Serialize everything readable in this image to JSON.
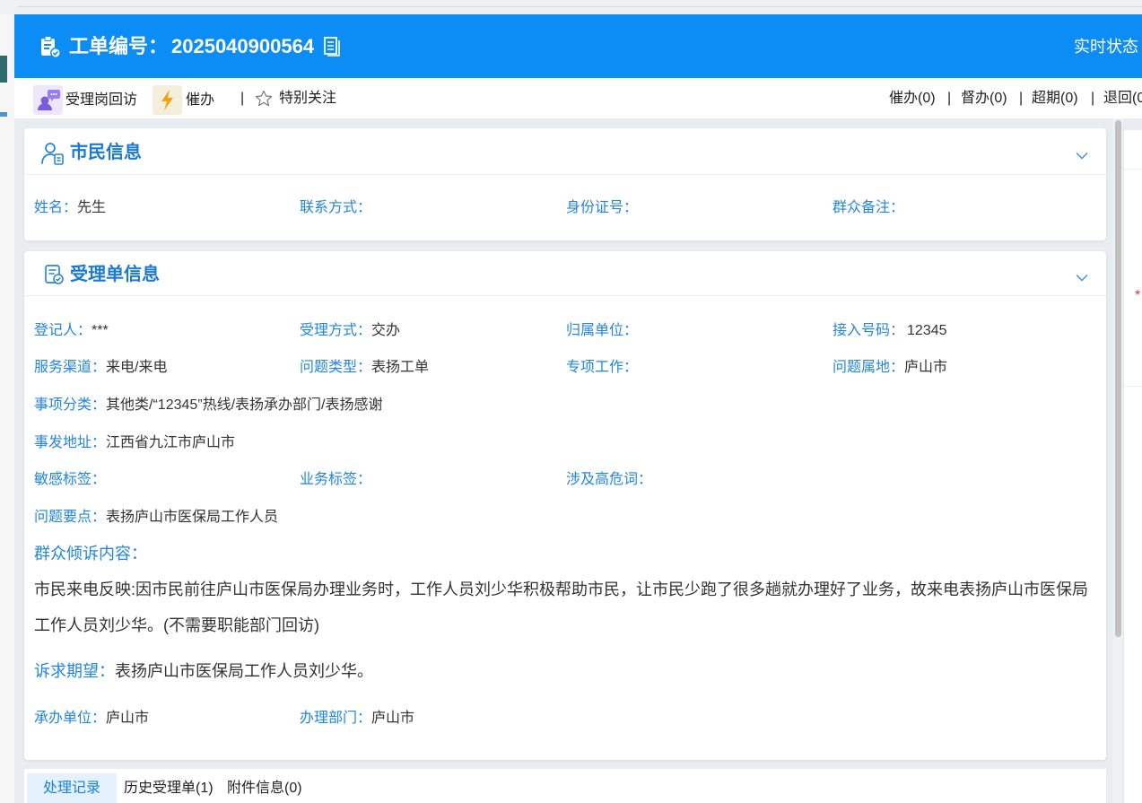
{
  "header": {
    "title_label": "工单编号：",
    "order_number": "2025040900564",
    "status_link": "实时状态"
  },
  "toolbar": {
    "separator": "|",
    "actions": [
      {
        "label": "受理岗回访",
        "icon": "user-chat-icon"
      },
      {
        "label": "催办",
        "icon": "lightning-icon"
      },
      {
        "label": "特别关注",
        "icon": "star-icon"
      }
    ],
    "counters": [
      "催办(0)",
      "督办(0)",
      "超期(0)",
      "退回(0"
    ]
  },
  "citizen": {
    "title": "市民信息",
    "name": {
      "label": "姓名：",
      "value": "先生"
    },
    "contact": {
      "label": "联系方式："
    },
    "id_number": {
      "label": "身份证号："
    },
    "remark": {
      "label": "群众备注："
    }
  },
  "acceptance": {
    "title": "受理单信息",
    "registrar": {
      "label": "登记人：",
      "value": "***"
    },
    "method": {
      "label": "受理方式：",
      "value": "交办"
    },
    "owner_unit": {
      "label": "归属单位："
    },
    "access_number": {
      "label": "接入号码：",
      "value": "12345"
    },
    "channel": {
      "label": "服务渠道：",
      "value": "来电/来电"
    },
    "issue_type": {
      "label": "问题类型：",
      "value": "表扬工单"
    },
    "special_work": {
      "label": "专项工作："
    },
    "issue_locale": {
      "label": "问题属地：",
      "value": "庐山市"
    },
    "category": {
      "label": "事项分类：",
      "value": "其他类/“12345”热线/表扬承办部门/表扬感谢"
    },
    "address": {
      "label": "事发地址：",
      "value": "江西省九江市庐山市"
    },
    "sensitive_tags": {
      "label": "敏感标签："
    },
    "business_tags": {
      "label": "业务标签："
    },
    "high_risk_words": {
      "label": "涉及高危词："
    },
    "key_points": {
      "label": "问题要点：",
      "value": "表扬庐山市医保局工作人员"
    },
    "complaint": {
      "label": "群众倾诉内容：",
      "content": "市民来电反映:因市民前往庐山市医保局办理业务时，工作人员刘少华积极帮助市民，让市民少跑了很多趟就办理好了业务，故来电表扬庐山市医保局工作人员刘少华。(不需要职能部门回访)"
    },
    "expectation": {
      "label": "诉求期望：",
      "value": "表扬庐山市医保局工作人员刘少华。"
    },
    "handling_unit": {
      "label": "承办单位：",
      "value": "庐山市"
    },
    "handling_dept": {
      "label": "办理部门：",
      "value": "庐山市"
    }
  },
  "tabs": [
    {
      "label": "处理记录",
      "active": true
    },
    {
      "label": "历史受理单(1)",
      "active": false
    },
    {
      "label": "附件信息(0)",
      "active": false
    }
  ],
  "side_panel": {
    "required_mark": "*"
  },
  "icons": {
    "header_title": "clipboard-check-icon",
    "header_copy": "document-icon",
    "citizen_section": "user-card-icon",
    "acceptance_section": "document-check-icon",
    "collapse": "chevron-down-icon"
  },
  "colors": {
    "header_bg": "#0b8df5",
    "label_blue": "#2286e0",
    "title_blue": "#1a7bd4",
    "page_bg": "#e9edf1",
    "active_tab_bg": "#e5f1fd",
    "active_tab_text": "#1684e6",
    "required_red": "#e53935",
    "icon_blue": "#2a84dc"
  }
}
